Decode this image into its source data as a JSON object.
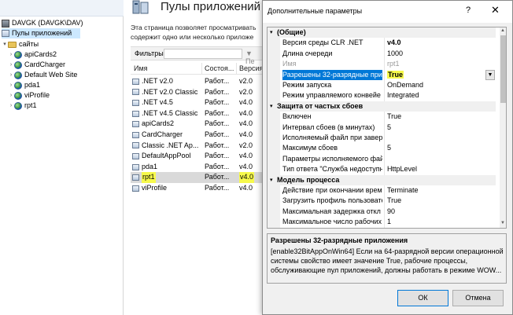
{
  "tree": {
    "root": "DAVGK (DAVGK\\DAV)",
    "pools_label": "Пулы приложений",
    "sites_label": "сайты",
    "sites": [
      "apiCards2",
      "CardCharger",
      "Default Web Site",
      "pda1",
      "viProfile",
      "rpt1"
    ]
  },
  "middle": {
    "title": "Пулы приложений",
    "description_line1": "Эта страница позволяет просматривать",
    "description_line2": "содержит одно или несколько приложе",
    "filter_label": "Фильтры:",
    "filter_go": "Пе",
    "columns": [
      "Имя",
      "Состоя...",
      "Версия"
    ],
    "pools": [
      {
        "name": ".NET v2.0",
        "state": "Работ...",
        "version": "v2.0"
      },
      {
        "name": ".NET v2.0 Classic",
        "state": "Работ...",
        "version": "v2.0"
      },
      {
        "name": ".NET v4.5",
        "state": "Работ...",
        "version": "v4.0"
      },
      {
        "name": ".NET v4.5 Classic",
        "state": "Работ...",
        "version": "v4.0"
      },
      {
        "name": "apiCards2",
        "state": "Работ...",
        "version": "v4.0"
      },
      {
        "name": "CardCharger",
        "state": "Работ...",
        "version": "v4.0"
      },
      {
        "name": "Classic .NET Ap...",
        "state": "Работ...",
        "version": "v2.0"
      },
      {
        "name": "DefaultAppPool",
        "state": "Работ...",
        "version": "v4.0"
      },
      {
        "name": "pda1",
        "state": "Работ...",
        "version": "v4.0"
      },
      {
        "name": "rpt1",
        "state": "Работ...",
        "version": "v4.0"
      },
      {
        "name": "viProfile",
        "state": "Работ...",
        "version": "v4.0"
      }
    ]
  },
  "dialog": {
    "title": "Дополнительные параметры",
    "help": "?",
    "close": "✕",
    "cat_general": "(Общие)",
    "general": [
      {
        "name": "Версия среды CLR .NET",
        "value": "v4.0"
      },
      {
        "name": "Длина очереди",
        "value": "1000"
      },
      {
        "name": "Имя",
        "value": "rpt1"
      },
      {
        "name": "Разрешены 32-разрядные при",
        "value": "True"
      },
      {
        "name": "Режим запуска",
        "value": "OnDemand"
      },
      {
        "name": "Режим управляемого конвейе",
        "value": "Integrated"
      }
    ],
    "cat_rapid": "Защита от частых сбоев",
    "rapid": [
      {
        "name": "Включен",
        "value": "True"
      },
      {
        "name": "Интервал сбоев (в минутах)",
        "value": "5"
      },
      {
        "name": "Исполняемый файл при завер",
        "value": ""
      },
      {
        "name": "Максимум сбоев",
        "value": "5"
      },
      {
        "name": "Параметры исполняемого фай",
        "value": ""
      },
      {
        "name": "Тип ответа \"Служба недоступн",
        "value": "HttpLevel"
      }
    ],
    "cat_process": "Модель процесса",
    "process": [
      {
        "name": "Действие при окончании врем",
        "value": "Terminate"
      },
      {
        "name": "Загрузить профиль пользовате",
        "value": "True"
      },
      {
        "name": "Максимальная задержка откл",
        "value": "90"
      },
      {
        "name": "Максимальное число рабочих",
        "value": "1"
      }
    ],
    "desc_title": "Разрешены 32-разрядные приложения",
    "desc_line1": "[enable32BitAppOnWin64] Если на 64-разрядной версии операционной",
    "desc_line2": "системы свойство имеет значение True, рабочие процессы,",
    "desc_line3": "обслуживающие пул приложений, должны работать в режиме WOW...",
    "ok": "ОК",
    "cancel": "Отмена"
  }
}
